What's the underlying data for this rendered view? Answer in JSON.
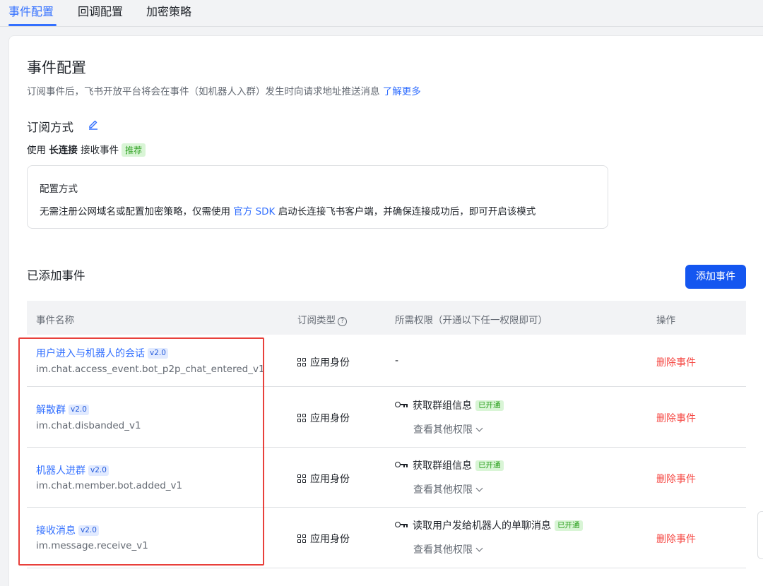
{
  "tabs": [
    {
      "label": "事件配置"
    },
    {
      "label": "回调配置"
    },
    {
      "label": "加密策略"
    }
  ],
  "page": {
    "title": "事件配置",
    "description": "订阅事件后，飞书开放平台将会在事件（如机器人入群）发生时向请求地址推送消息",
    "learn_more": "了解更多"
  },
  "subscription": {
    "heading": "订阅方式",
    "mode_prefix": "使用",
    "mode_name": "长连接",
    "mode_suffix": "接收事件",
    "recommend_badge": "推荐",
    "config_title": "配置方式",
    "config_text_1": "无需注册公网域名或配置加密策略，仅需使用",
    "config_link": "官方 SDK",
    "config_text_2": "启动长连接飞书客户端，并确保连接成功后，即可开启该模式"
  },
  "events": {
    "heading": "已添加事件",
    "add_button": "添加事件",
    "columns": {
      "name": "事件名称",
      "type": "订阅类型",
      "perms": "所需权限（开通以下任一权限即可）",
      "action": "操作"
    },
    "rows": [
      {
        "name": "用户进入与机器人的会话",
        "version": "v2.0",
        "id": "im.chat.access_event.bot_p2p_chat_entered_v1",
        "identity": "应用身份",
        "permission": "-",
        "delete": "删除事件"
      },
      {
        "name": "解散群",
        "version": "v2.0",
        "id": "im.chat.disbanded_v1",
        "identity": "应用身份",
        "permission": "获取群组信息",
        "status": "已开通",
        "more": "查看其他权限",
        "delete": "删除事件"
      },
      {
        "name": "机器人进群",
        "version": "v2.0",
        "id": "im.chat.member.bot.added_v1",
        "identity": "应用身份",
        "permission": "获取群组信息",
        "status": "已开通",
        "more": "查看其他权限",
        "delete": "删除事件"
      },
      {
        "name": "接收消息",
        "version": "v2.0",
        "id": "im.message.receive_v1",
        "identity": "应用身份",
        "permission": "读取用户发给机器人的单聊消息",
        "status": "已开通",
        "more": "查看其他权限",
        "delete": "删除事件"
      }
    ]
  },
  "colors": {
    "primary": "#3370ff",
    "button": "#1456f0",
    "danger": "#f54a45",
    "success": "#2ea121",
    "highlight_box": "#e8403b"
  },
  "icons": {
    "edit": "edit-pencil-icon",
    "help": "question-circle-icon",
    "identity": "app-grid-icon",
    "permission": "key-icon",
    "expand": "chevron-down-icon"
  }
}
